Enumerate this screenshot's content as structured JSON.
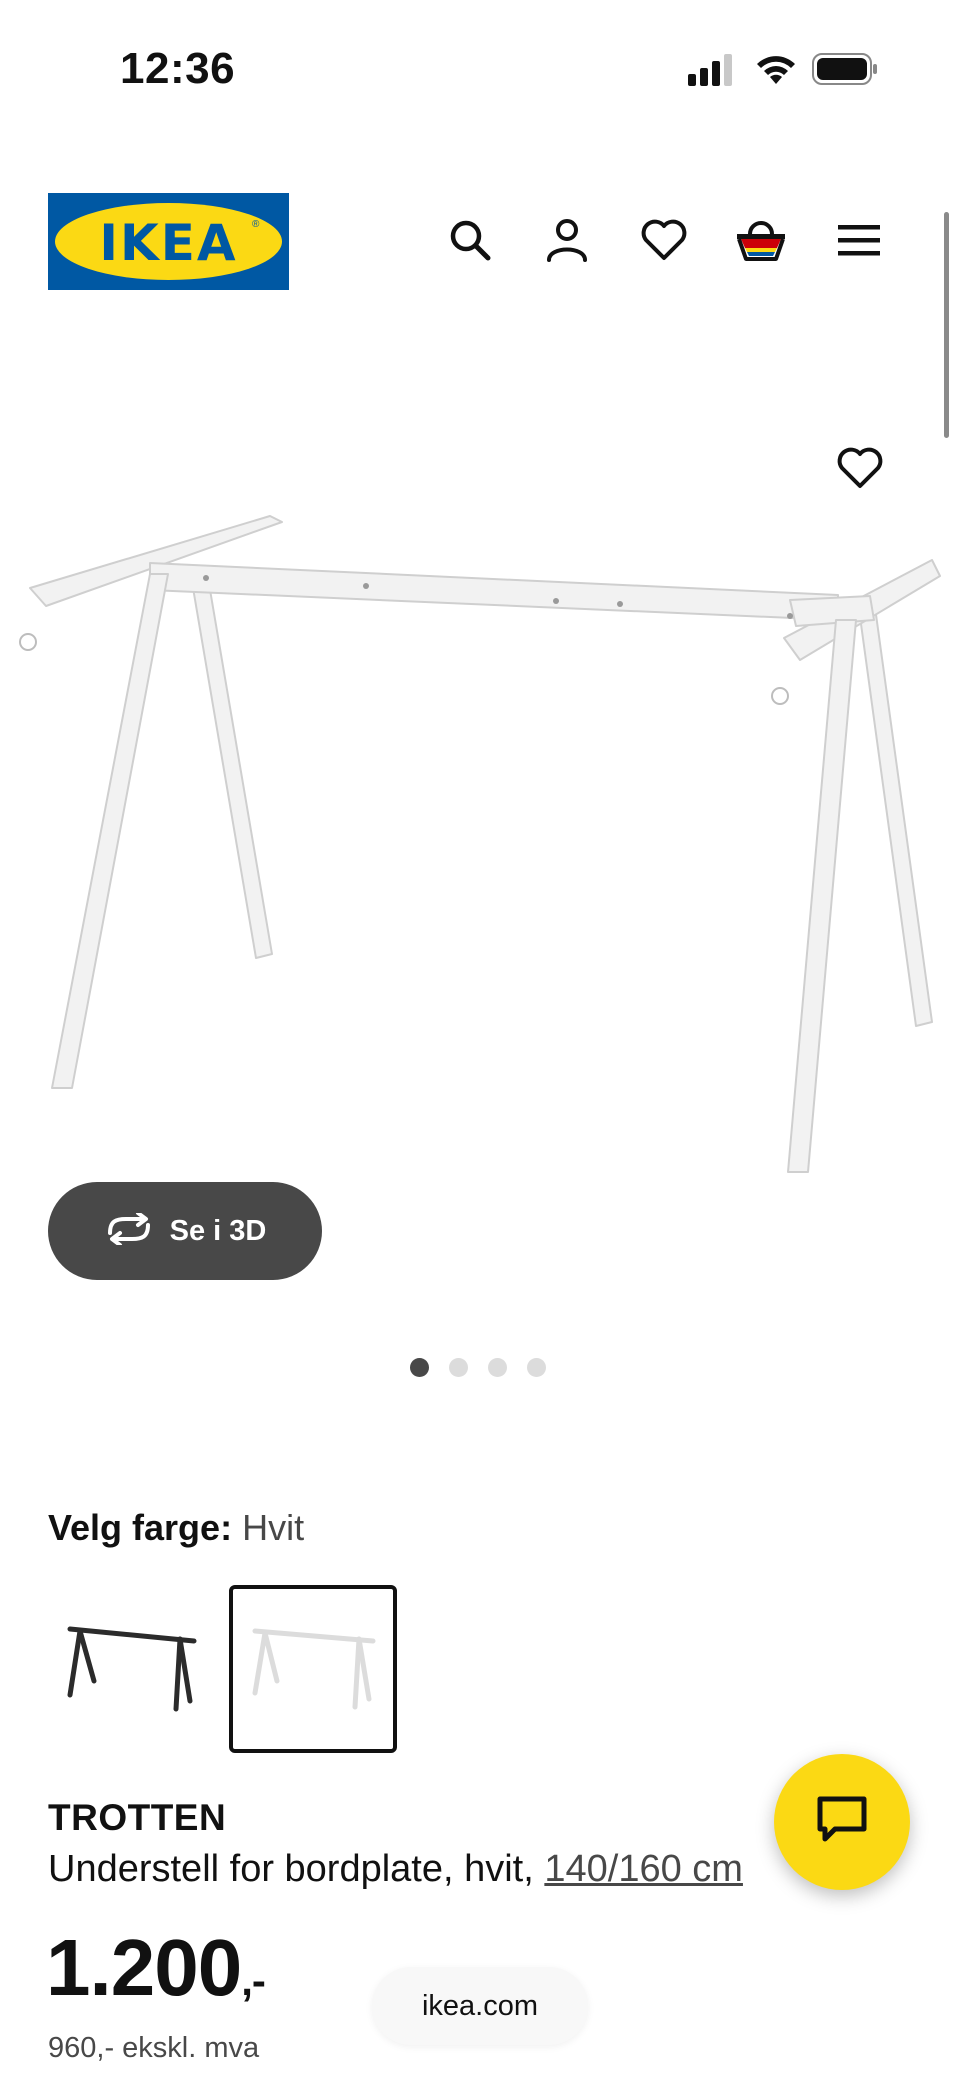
{
  "status_bar": {
    "time": "12:36"
  },
  "header": {
    "logo_text": "IKEA",
    "logo_reg": "®",
    "icons": [
      "search-icon",
      "account-icon",
      "heart-icon",
      "cart-icon",
      "menu-icon"
    ]
  },
  "gallery": {
    "view_3d_label": "Se i 3D",
    "dot_count": 4,
    "active_dot": 1
  },
  "colour": {
    "label": "Velg farge:",
    "value": "Hvit",
    "options": [
      "black-frame-thumbnail",
      "white-frame-thumbnail"
    ],
    "selected": 2
  },
  "product": {
    "name": "TROTTEN",
    "description": "Understell for bordplate, hvit, ",
    "size_link": "140/160 cm",
    "price_main": "1.200",
    "price_suffix": ",-",
    "price_ex_vat": "960,- ekskl. mva"
  },
  "browser": {
    "url": "ikea.com"
  },
  "colors": {
    "ikea_blue": "#0058a3",
    "ikea_yellow": "#fbd914",
    "dark_button": "#484848"
  }
}
